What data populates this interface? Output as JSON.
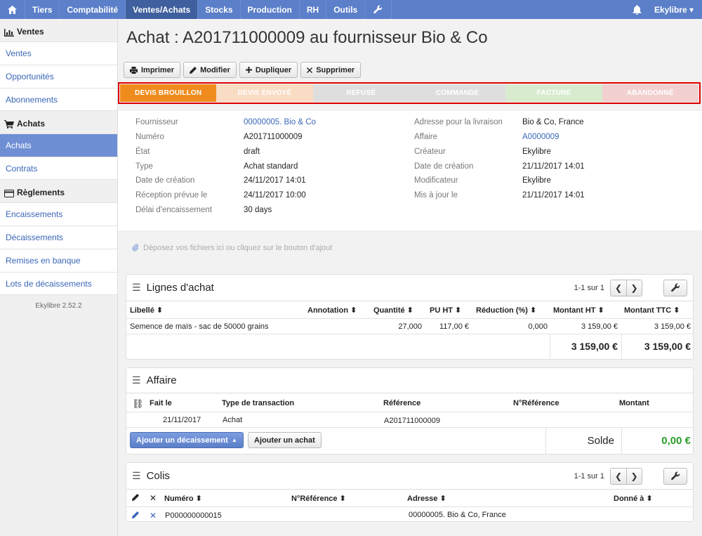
{
  "topbar": {
    "items": [
      {
        "label": "Tiers"
      },
      {
        "label": "Comptabilité"
      },
      {
        "label": "Ventes/Achats"
      },
      {
        "label": "Stocks"
      },
      {
        "label": "Production"
      },
      {
        "label": "RH"
      },
      {
        "label": "Outils"
      }
    ],
    "user": "Ekylibre ▾"
  },
  "sidebar": {
    "sections": [
      {
        "title": "Ventes",
        "items": [
          "Ventes",
          "Opportunités",
          "Abonnements"
        ]
      },
      {
        "title": "Achats",
        "items": [
          "Achats",
          "Contrats"
        ]
      },
      {
        "title": "Règlements",
        "items": [
          "Encaissements",
          "Décaissements",
          "Remises en banque",
          "Lots de décaissements"
        ]
      }
    ],
    "version": "Ekylibre 2.52.2"
  },
  "page": {
    "title": "Achat : A201711000009 au fournisseur Bio & Co",
    "buttons": [
      "Imprimer",
      "Modifier",
      "Dupliquer",
      "Supprimer"
    ]
  },
  "steps": [
    {
      "label": "DEVIS BROUILLON",
      "color": "#f08c1e"
    },
    {
      "label": "DEVIS ENVOYÉ",
      "color": "#f9dcc4"
    },
    {
      "label": "REFUSÉ",
      "color": "#dedede"
    },
    {
      "label": "COMMANDE",
      "color": "#dedede"
    },
    {
      "label": "FACTURE",
      "color": "#d8ebcf"
    },
    {
      "label": "ABANDONNÉ",
      "color": "#f2d0d0"
    }
  ],
  "info": {
    "left": [
      {
        "label": "Fournisseur",
        "value": "00000005. Bio & Co",
        "link": true
      },
      {
        "label": "Numéro",
        "value": "A201711000009"
      },
      {
        "label": "État",
        "value": "draft"
      },
      {
        "label": "Type",
        "value": "Achat standard"
      },
      {
        "label": "Date de création",
        "value": "24/11/2017 14:01"
      },
      {
        "label": "Réception prévue le",
        "value": "24/11/2017 10:00"
      },
      {
        "label": "Délai d'encaissement",
        "value": "30 days"
      }
    ],
    "right": [
      {
        "label": "Adresse pour la livraison",
        "value": "Bio & Co, France"
      },
      {
        "label": "Affaire",
        "value": "A0000009",
        "link": true
      },
      {
        "label": "Créateur",
        "value": "Ekylibre"
      },
      {
        "label": "Date de création",
        "value": "21/11/2017 14:01"
      },
      {
        "label": "Modificateur",
        "value": "Ekylibre"
      },
      {
        "label": "Mis à jour le",
        "value": "21/11/2017 14:01"
      }
    ]
  },
  "dropzone": "Déposez vos fichiers ici ou cliquez sur le bouton d'ajout",
  "lignes": {
    "title": "Lignes d'achat",
    "pager": "1-1 sur 1",
    "headers": [
      "Libellé ⬍",
      "Annotation ⬍",
      "Quantité ⬍",
      "PU HT ⬍",
      "Réduction (%) ⬍",
      "Montant HT ⬍",
      "Montant TTC ⬍"
    ],
    "row": [
      "Semence de maïs - sac de 50000 grains",
      "27,000",
      "117,00 €",
      "0,000",
      "3 159,00 €",
      "3 159,00 €"
    ],
    "total_ht": "3 159,00 €",
    "total_ttc": "3 159,00 €"
  },
  "affaire": {
    "title": "Affaire",
    "headers": [
      "Fait le",
      "Type de transaction",
      "Référence",
      "N°Référence",
      "Montant"
    ],
    "row": {
      "date": "21/11/2017",
      "type": "Achat",
      "ref": "A201711000009"
    },
    "btn_decaissement": "Ajouter un décaissement",
    "btn_achat": "Ajouter un achat",
    "solde_label": "Solde",
    "solde_value": "0,00 €"
  },
  "colis": {
    "title": "Colis",
    "pager": "1-1 sur 1",
    "headers": [
      "Numéro ⬍",
      "N°Référence ⬍",
      "Adresse ⬍",
      "Donné à ⬍"
    ],
    "row": {
      "numero": "P000000000015",
      "adresse": "00000005. Bio & Co, France"
    }
  }
}
